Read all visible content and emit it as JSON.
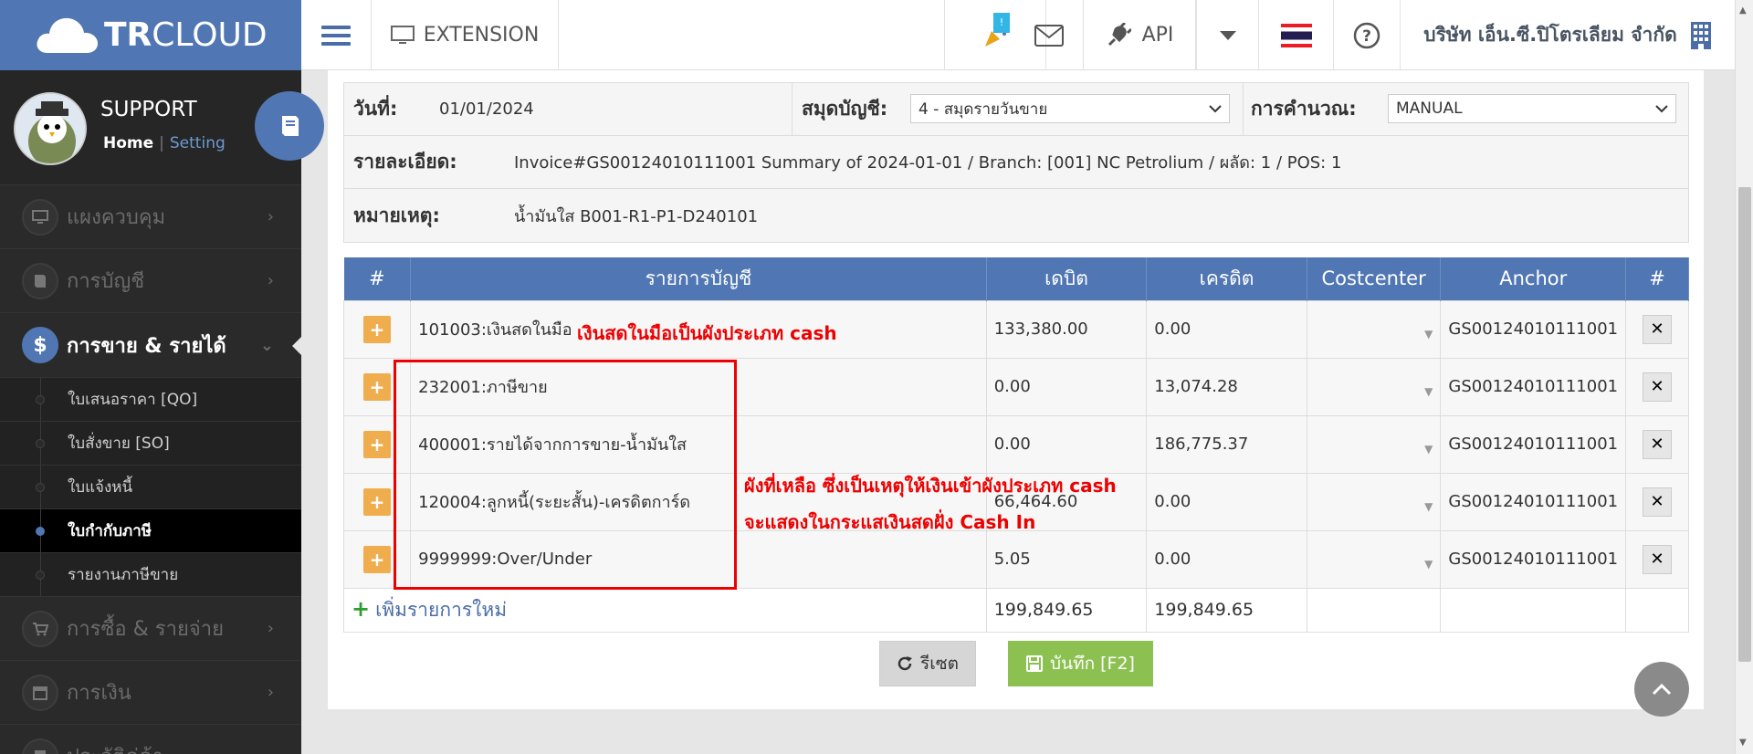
{
  "brand": {
    "logo_bold": "TR",
    "logo_light": "CLOUD",
    "color": "#5077b3"
  },
  "topbar": {
    "extension_label": "EXTENSION",
    "notification_badge": "!",
    "api_label": "API",
    "company_name": "บริษัท เอ็น.ซี.ปิโตรเลียม จำกัด"
  },
  "sidebar": {
    "user_name": "SUPPORT",
    "home_link": "Home",
    "separator": "|",
    "setting_link": "Setting",
    "menu": [
      {
        "label": "แผงควบคุม",
        "icon": "monitor-icon"
      },
      {
        "label": "การบัญชี",
        "icon": "book-icon"
      },
      {
        "label": "การขาย & รายได้",
        "icon": "dollar-icon"
      },
      {
        "label": "การซื้อ & รายจ่าย",
        "icon": "cart-icon"
      },
      {
        "label": "การเงิน",
        "icon": "calendar-icon"
      },
      {
        "label": "ประวัติคู่ค้า",
        "icon": "contact-icon"
      }
    ],
    "submenu": [
      {
        "label": "ใบเสนอราคา [QO]"
      },
      {
        "label": "ใบสั่งขาย [SO]"
      },
      {
        "label": "ใบแจ้งหนี้"
      },
      {
        "label": "ใบกำกับภาษี"
      },
      {
        "label": "รายงานภาษีขาย"
      }
    ]
  },
  "form": {
    "date_label": "วันที่:",
    "date_value": "01/01/2024",
    "journal_label": "สมุดบัญชี:",
    "journal_value": "4 - สมุดรายวันขาย",
    "calc_label": "การคำนวณ:",
    "calc_value": "MANUAL",
    "detail_label": "รายละเอียด:",
    "detail_value": "Invoice#GS00124010111001 Summary of 2024-01-01 / Branch: [001] NC Petrolium / ผลัด: 1 / POS: 1",
    "note_label": "หมายเหตุ:",
    "note_value": "น้ำมันใส B001-R1-P1-D240101"
  },
  "grid": {
    "headers": {
      "hash": "#",
      "account": "รายการบัญชี",
      "debit": "เดบิต",
      "credit": "เครดิต",
      "costcenter": "Costcenter",
      "anchor": "Anchor",
      "hash2": "#"
    },
    "rows": [
      {
        "account": "101003:เงินสดในมือ",
        "debit": "133,380.00",
        "credit": "0.00",
        "anchor": "GS00124010111001"
      },
      {
        "account": "232001:ภาษีขาย",
        "debit": "0.00",
        "credit": "13,074.28",
        "anchor": "GS00124010111001"
      },
      {
        "account": "400001:รายได้จากการขาย-น้ำมันใส",
        "debit": "0.00",
        "credit": "186,775.37",
        "anchor": "GS00124010111001"
      },
      {
        "account": "120004:ลูกหนี้(ระยะสั้น)-เครดิตการ์ด",
        "debit": "66,464.60",
        "credit": "0.00",
        "anchor": "GS00124010111001"
      },
      {
        "account": "9999999:Over/Under",
        "debit": "5.05",
        "credit": "0.00",
        "anchor": "GS00124010111001"
      }
    ],
    "add_label": "เพิ่มรายการใหม่",
    "total_debit": "199,849.65",
    "total_credit": "199,849.65"
  },
  "buttons": {
    "reset": "รีเซต",
    "save": "บันทึก [F2]"
  },
  "annotations": {
    "cash_note": "เงินสดในมือเป็นผังประเภท cash",
    "other_note_line1": "ผังที่เหลือ ซึ่งเป็นเหตุให้เงินเข้าผังประเภท cash",
    "other_note_line2": "จะแสดงในกระแสเงินสดฝั่ง Cash In",
    "color": "#ee0000"
  }
}
